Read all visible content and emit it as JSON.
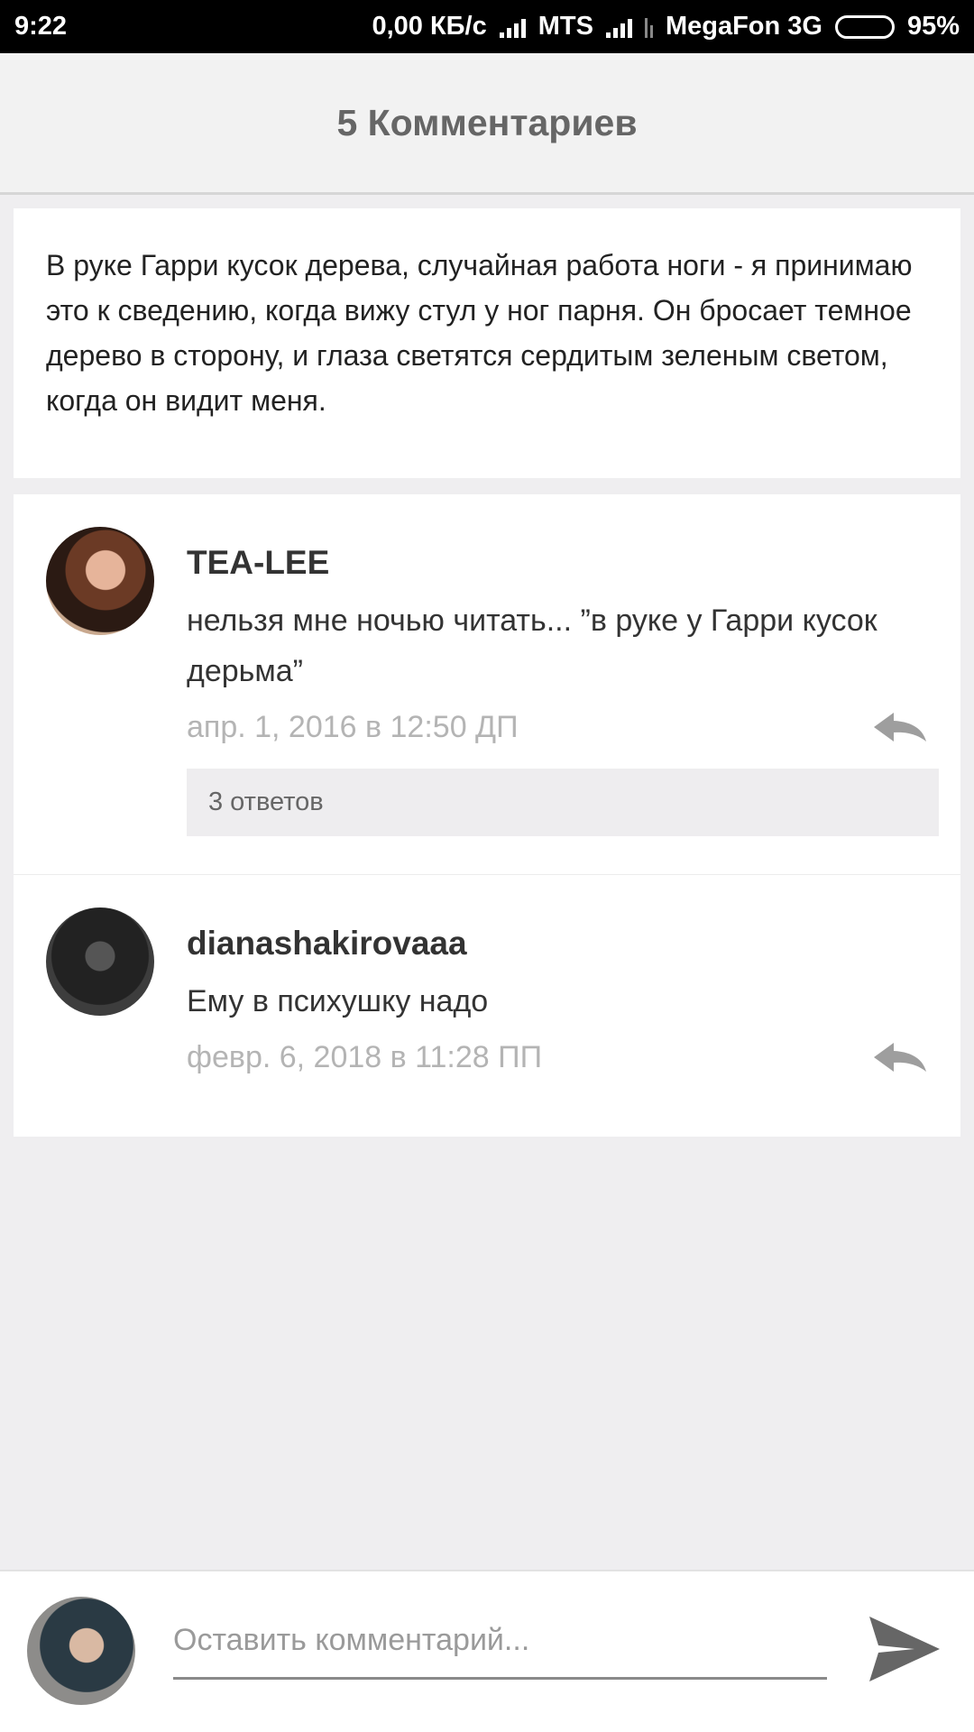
{
  "status_bar": {
    "time": "9:22",
    "speed": "0,00 КБ/с",
    "carrier1": "MTS",
    "carrier2": "MegaFon 3G",
    "battery": "95%"
  },
  "header": {
    "title": "5 Комментариев"
  },
  "excerpt": {
    "text": "В руке Гарри кусок дерева, случайная работа ноги - я принимаю это к сведению, когда вижу стул у ног парня. Он бросает темное дерево в сторону, и глаза светятся сердитым зеленым светом, когда он видит меня."
  },
  "comments": [
    {
      "author": "TEA-LEE",
      "text": "нельзя мне ночью читать... ”в руке у Гарри кусок дерьма”",
      "date": "апр. 1, 2016 в 12:50 ДП",
      "replies_label": "3 ответов"
    },
    {
      "author": "dianashakirovaaa",
      "text": "Ему в психушку надо",
      "date": "февр. 6, 2018 в 11:28 ПП"
    }
  ],
  "composer": {
    "placeholder": "Оставить комментарий..."
  },
  "icons": {
    "reply": "reply-icon",
    "send": "send-icon"
  },
  "colors": {
    "date_gray": "#b4b4b4",
    "icon_gray": "#9e9e9e",
    "send_gray": "#666666"
  }
}
